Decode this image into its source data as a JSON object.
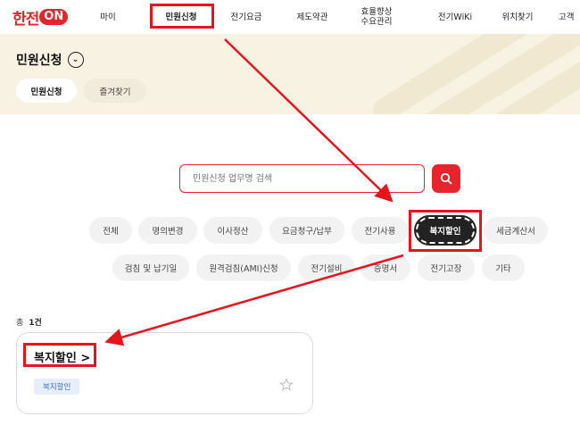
{
  "header": {
    "logo_text": "한전",
    "logo_on": "ON",
    "nav": [
      "마이",
      "민원신청",
      "전기요금",
      "제도약관",
      "효율향상",
      "수요관리",
      "전기WiKi",
      "위치찾기",
      "고객"
    ]
  },
  "page": {
    "title": "민원신청",
    "tab_active": "민원신청",
    "tab_other": "즐겨찾기"
  },
  "search": {
    "placeholder": "민원신청 업무명 검색"
  },
  "chips": {
    "row1": [
      "전체",
      "명의변경",
      "이사정산",
      "요금청구/납부",
      "전기사용",
      "복지할인",
      "세금계산서"
    ],
    "row2": [
      "검침 및 납기일",
      "원격검침(AMI)신청",
      "전기설비",
      "증명서",
      "전기고장",
      "기타"
    ]
  },
  "result": {
    "count_prefix": "총",
    "count_value": "1건"
  },
  "card": {
    "title": "복지할인 >",
    "badge": "복지할인"
  },
  "colors": {
    "brand_red": "#e5242b",
    "annotation_red": "#e8141b",
    "banner": "#f8f2e2",
    "badge_text": "#3b6fd1"
  }
}
